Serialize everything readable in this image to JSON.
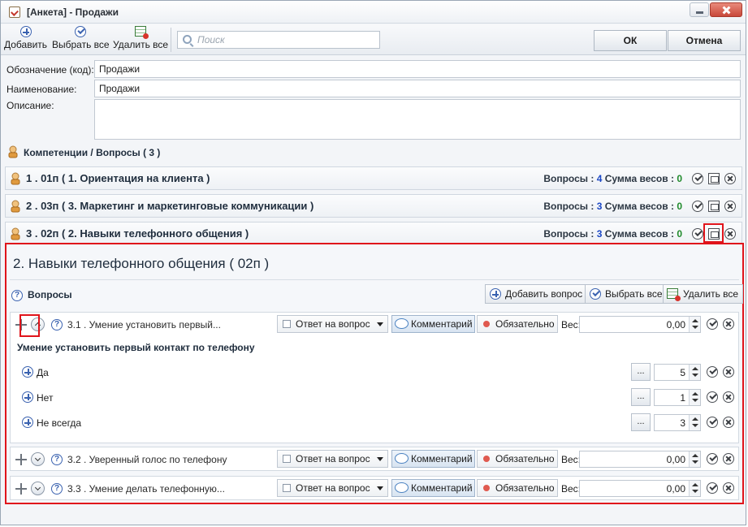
{
  "window": {
    "title": "[Анкета] - Продажи"
  },
  "toolbar": {
    "add_label": "Добавить",
    "select_all_label": "Выбрать все",
    "delete_all_label": "Удалить все",
    "search_placeholder": "Поиск",
    "ok_label": "ОК",
    "cancel_label": "Отмена"
  },
  "form": {
    "code_label": "Обозначение (код):",
    "code_value": "Продажи",
    "name_label": "Наименование:",
    "name_value": "Продажи",
    "description_label": "Описание:",
    "description_value": ""
  },
  "breadcrumb": "Компетенции / Вопросы ( 3 )",
  "competencies": [
    {
      "title": "1 . 01п ( 1. Ориентация на клиента )",
      "questions_label": "Вопросы :",
      "questions_count": "4",
      "weights_label": "Сумма весов :",
      "weights_sum": "0"
    },
    {
      "title": "2 . 03п ( 3. Маркетинг и маркетинговые коммуникации  )",
      "questions_label": "Вопросы :",
      "questions_count": "3",
      "weights_label": "Сумма весов :",
      "weights_sum": "0"
    },
    {
      "title": "3 . 02п ( 2. Навыки телефонного общения )",
      "questions_label": "Вопросы :",
      "questions_count": "3",
      "weights_label": "Сумма весов :",
      "weights_sum": "0"
    }
  ],
  "panel": {
    "title": "2. Навыки телефонного общения ( 02п )",
    "questions_heading": "Вопросы",
    "add_question_label": "Добавить вопрос",
    "select_all_label": "Выбрать все",
    "delete_all_label": "Удалить все",
    "questions": [
      {
        "text": "3.1 . Умение установить первый...",
        "answer_type": "Ответ на вопрос",
        "comment_label": "Комментарий",
        "required_label": "Обязательно",
        "weight_label": "Вес:",
        "weight": "0,00",
        "detail_title": "Умение установить первый контакт по телефону",
        "answers": [
          {
            "text": "Да",
            "dots": "...",
            "value": "5"
          },
          {
            "text": "Нет",
            "dots": "...",
            "value": "1"
          },
          {
            "text": "Не всегда",
            "dots": "...",
            "value": "3"
          }
        ]
      },
      {
        "text": "3.2 . Уверенный голос по телефону",
        "answer_type": "Ответ на вопрос",
        "comment_label": "Комментарий",
        "required_label": "Обязательно",
        "weight_label": "Вес:",
        "weight": "0,00"
      },
      {
        "text": "3.3 . Умение делать телефонную...",
        "answer_type": "Ответ на вопрос",
        "comment_label": "Комментарий",
        "required_label": "Обязательно",
        "weight_label": "Вес:",
        "weight": "0,00"
      }
    ]
  },
  "colors": {
    "highlight_red": "#e0141b",
    "accent_blue": "#1b47c4",
    "accent_green": "#1e8a2a"
  }
}
